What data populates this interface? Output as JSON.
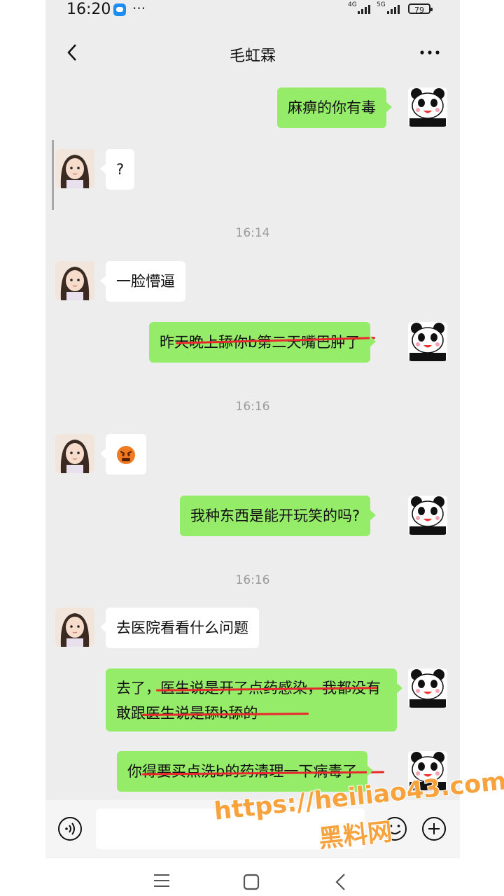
{
  "status_bar": {
    "time": "16:20",
    "dots": "···",
    "net1": "4G",
    "net2": "5G",
    "battery": "79"
  },
  "header": {
    "title": "毛虹霖"
  },
  "messages": {
    "m1": "麻痹的你有毒",
    "m2": "?",
    "t1": "16:14",
    "m3": "一脸懵逼",
    "m4": "昨天晚上舔你b第二天嘴巴肿了",
    "t2": "16:16",
    "m6": "我种东西是能开玩笑的吗?",
    "t3": "16:16",
    "m7": "去医院看看什么问题",
    "m8": "去了，医生说是开了点药感染，我都没有敢跟医生说是舔b舔的",
    "m9": "你得要买点洗b的药清理一下病毒了"
  },
  "watermark": {
    "url": "https://heiliao43.com",
    "name": "黑料网"
  },
  "icons": {
    "back": "chevron-left-icon",
    "more": "more-icon",
    "voice": "voice-icon",
    "emoji": "emoji-icon",
    "plus": "plus-icon",
    "menu": "menu-icon",
    "home": "home-icon",
    "nav_back": "nav-back-icon"
  },
  "colors": {
    "self_bubble": "#95ec69",
    "other_bubble": "#ffffff",
    "chat_bg": "#ededed",
    "strike": "#e8282c",
    "watermark": "#f7a23d"
  }
}
